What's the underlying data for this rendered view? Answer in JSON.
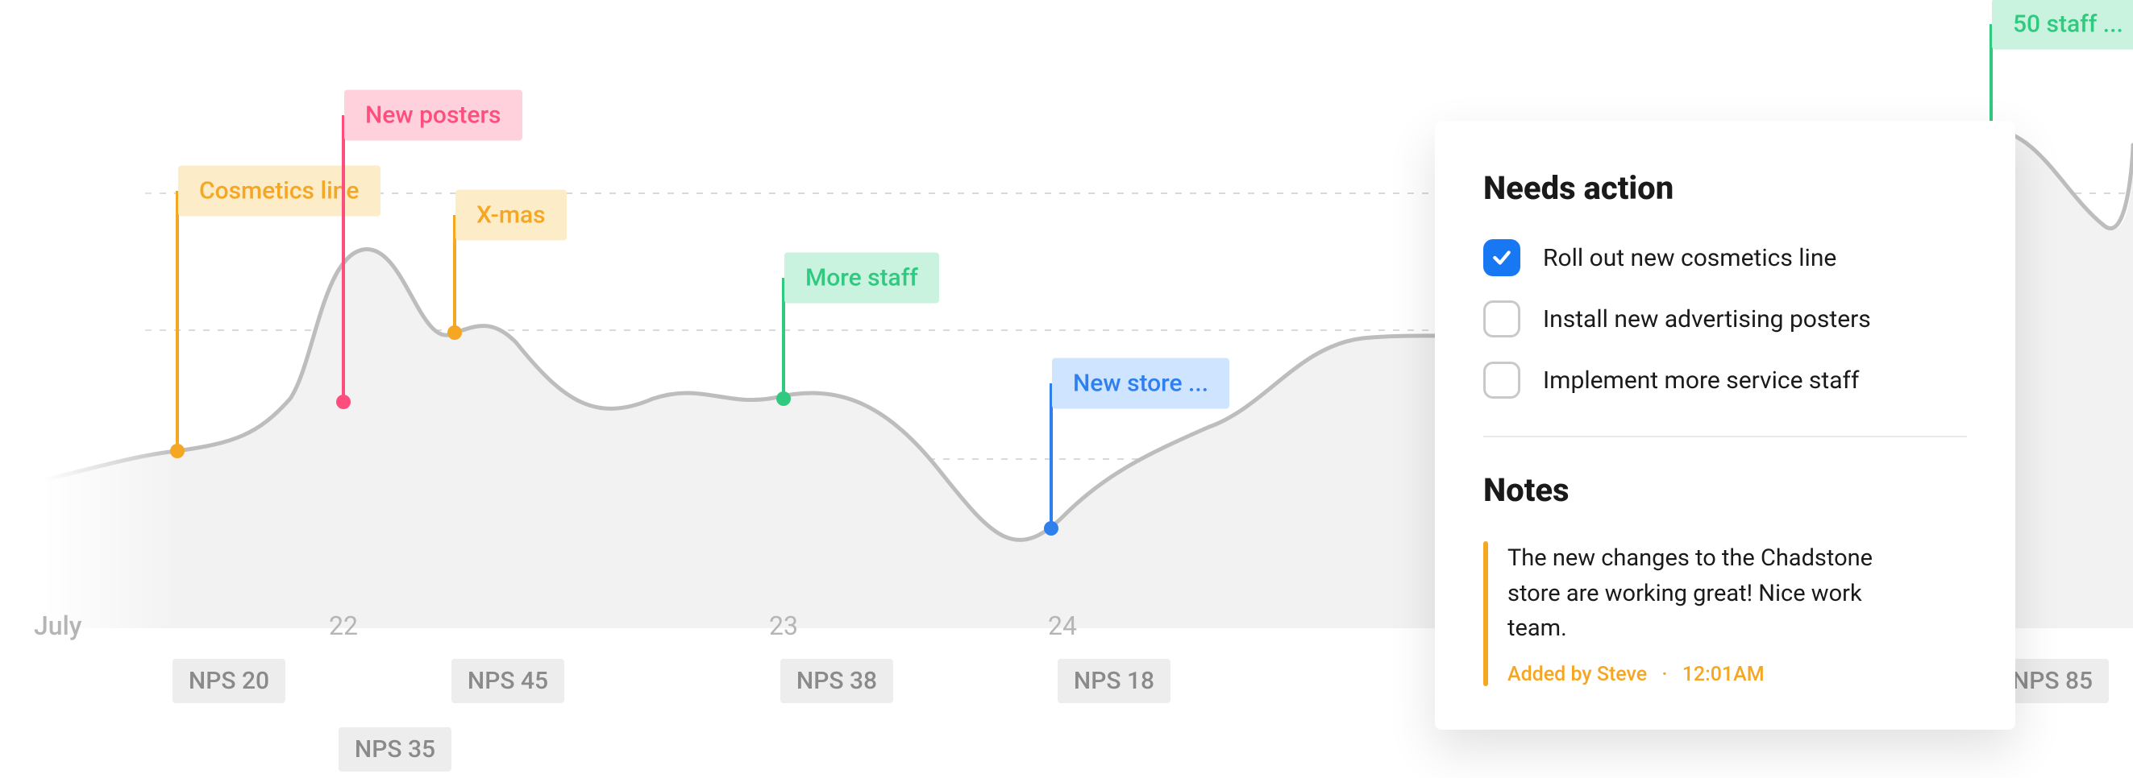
{
  "chart_data": {
    "type": "line",
    "title": "",
    "xlabel": "",
    "ylabel": "NPS",
    "ylim": [
      0,
      100
    ],
    "x_ticks": [
      {
        "label": "July",
        "kind": "month"
      },
      {
        "label": "22",
        "kind": "day"
      },
      {
        "label": "23",
        "kind": "day"
      },
      {
        "label": "24",
        "kind": "day"
      }
    ],
    "series": [
      {
        "name": "NPS",
        "x_labels": [
          "Cosmetics line",
          "New posters",
          "X-mas",
          "More staff",
          "New store ...",
          "50 staff ..."
        ],
        "values": [
          20,
          35,
          45,
          38,
          18,
          85
        ]
      }
    ],
    "annotations": [
      {
        "label": "Cosmetics line",
        "nps": 20,
        "color": "orange"
      },
      {
        "label": "New posters",
        "nps": 35,
        "color": "pink"
      },
      {
        "label": "X-mas",
        "nps": 45,
        "color": "orange"
      },
      {
        "label": "More staff",
        "nps": 38,
        "color": "green"
      },
      {
        "label": "New store ...",
        "nps": 18,
        "color": "blue"
      },
      {
        "label": "50 staff ...",
        "nps": 85,
        "color": "green"
      }
    ]
  },
  "axis": {
    "month": "July",
    "ticks": [
      "22",
      "23",
      "24"
    ]
  },
  "markers": {
    "cosmetics": {
      "label": "Cosmetics line",
      "nps_label": "NPS 20"
    },
    "posters": {
      "label": "New posters",
      "nps_label": "NPS 35"
    },
    "xmas": {
      "label": "X-mas",
      "nps_label": "NPS 45"
    },
    "staff": {
      "label": "More staff",
      "nps_label": "NPS 38"
    },
    "store": {
      "label": "New store ...",
      "nps_label": "NPS 18"
    },
    "big_staff": {
      "label": "50 staff ...",
      "nps_label": "NPS 85"
    }
  },
  "card": {
    "needs_action_title": "Needs action",
    "tasks": [
      {
        "label": "Roll out new cosmetics line",
        "checked": true
      },
      {
        "label": "Install new advertising posters",
        "checked": false
      },
      {
        "label": "Implement more service staff",
        "checked": false
      }
    ],
    "notes_title": "Notes",
    "note_body": "The new changes to the Chadstone store are working great! Nice work team.",
    "note_author": "Added by Steve",
    "note_time": "12:01AM"
  }
}
